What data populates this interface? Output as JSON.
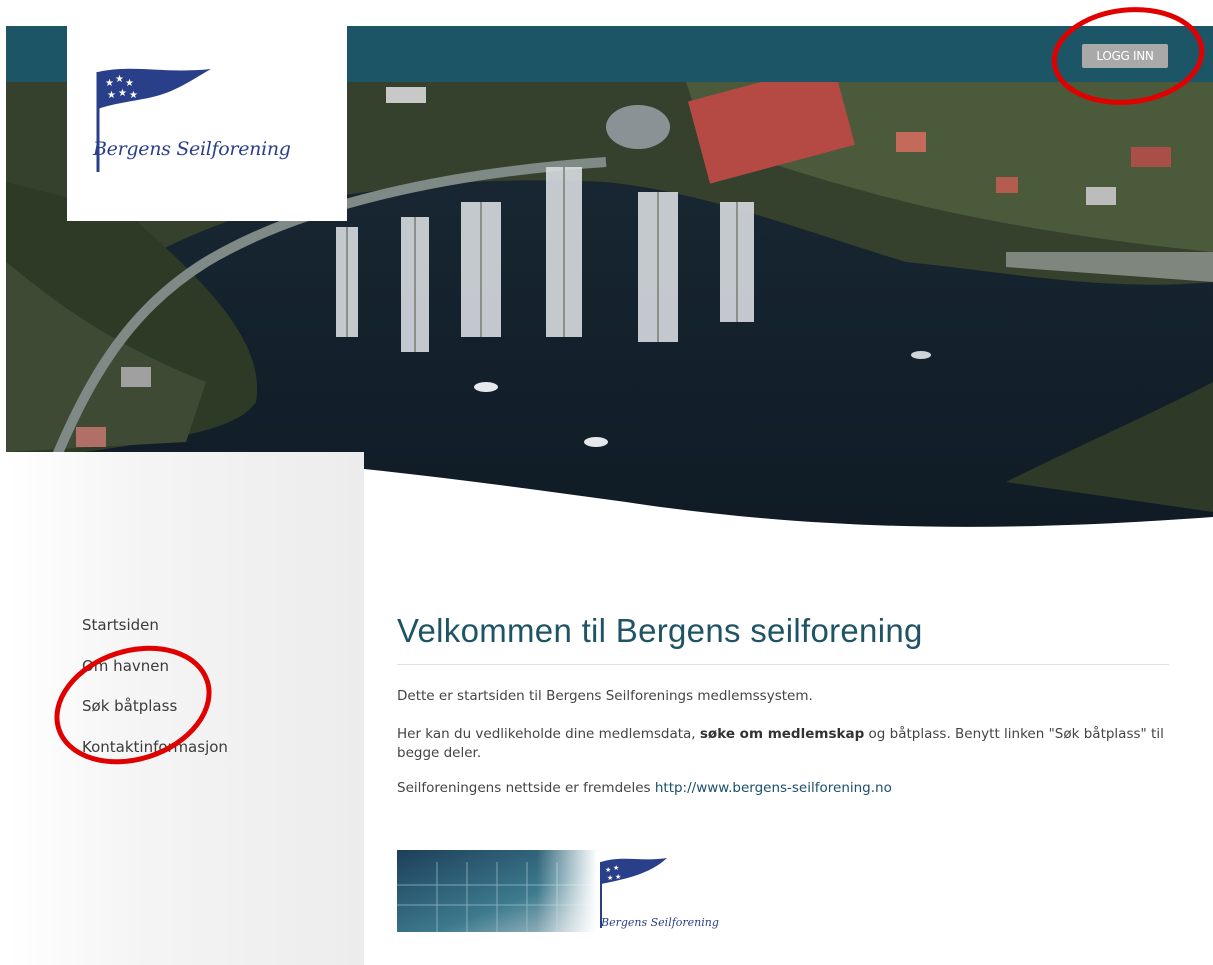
{
  "header": {
    "login_label": "LOGG INN"
  },
  "logo": {
    "text": "Bergens Seilforening"
  },
  "nav": {
    "items": [
      {
        "label": "Startsiden"
      },
      {
        "label": "Om havnen"
      },
      {
        "label": "Søk båtplass"
      },
      {
        "label": "Kontaktinformasjon"
      }
    ]
  },
  "main": {
    "title": "Velkommen til Bergens seilforening",
    "p1": "Dette er startsiden til Bergens Seilforenings medlemssystem.",
    "p2_prefix": "Her kan du vedlikeholde dine medlemsdata, ",
    "p2_bold": "søke om medlemskap",
    "p2_suffix": " og båtplass. Benytt linken \"Søk båtplass\" til begge deler.",
    "p3_prefix": "Seilforeningens nettside er fremdeles ",
    "p3_link": "http://www.bergens-seilforening.no"
  },
  "footer_logo": {
    "text": "Bergens Seilforening"
  },
  "colors": {
    "topbar": "#1b5566",
    "title": "#1f5466",
    "logo_blue": "#2a3f8a",
    "callout": "#e00000"
  }
}
